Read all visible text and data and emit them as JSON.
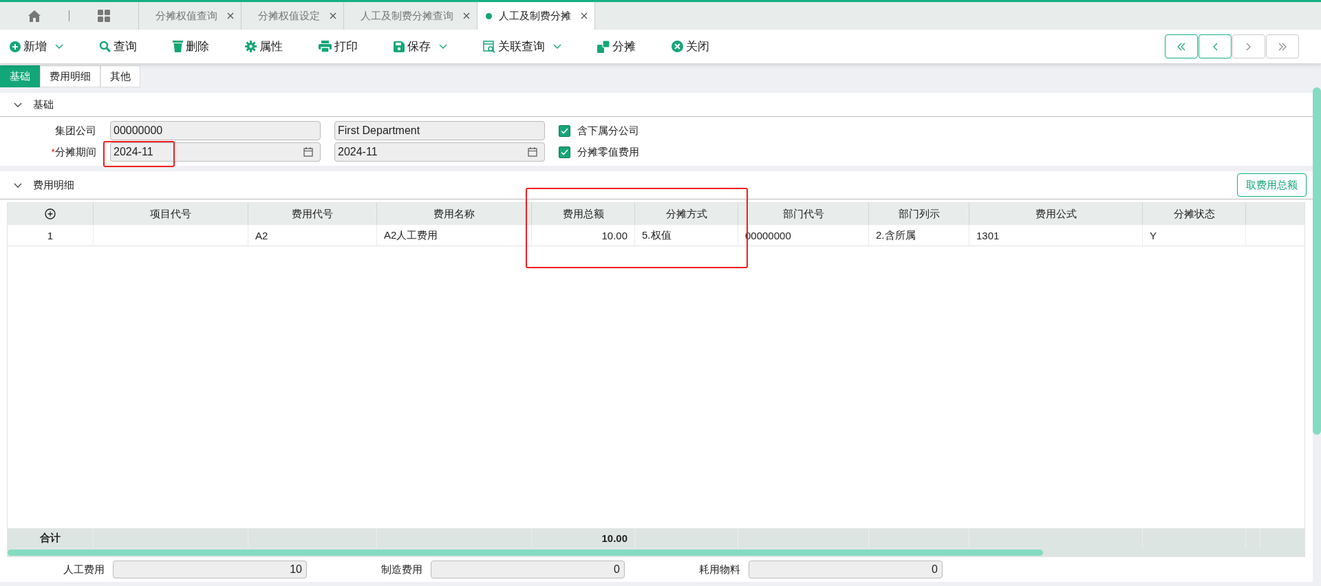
{
  "top_tabs": [
    {
      "label": "分摊权值查询",
      "selected": false
    },
    {
      "label": "分摊权值设定",
      "selected": false
    },
    {
      "label": "人工及制费分摊查询",
      "selected": false
    },
    {
      "label": "人工及制费分摊",
      "selected": true
    }
  ],
  "toolbar": [
    {
      "label": "新增",
      "dropdown": true
    },
    {
      "label": "查询",
      "dropdown": false
    },
    {
      "label": "删除",
      "dropdown": false
    },
    {
      "label": "属性",
      "dropdown": false
    },
    {
      "label": "打印",
      "dropdown": false
    },
    {
      "label": "保存",
      "dropdown": true
    },
    {
      "label": "关联查询",
      "dropdown": true
    },
    {
      "label": "分摊",
      "dropdown": false
    },
    {
      "label": "关闭",
      "dropdown": false
    }
  ],
  "pager": [
    {
      "disabled": false
    },
    {
      "disabled": false
    },
    {
      "disabled": true
    },
    {
      "disabled": true
    }
  ],
  "sub_tabs": [
    {
      "label": "基础",
      "selected": true
    },
    {
      "label": "费用明细",
      "selected": false
    },
    {
      "label": "其他",
      "selected": false
    }
  ],
  "basic_section": {
    "title": "基础",
    "expanded": true,
    "fields": [
      {
        "label": "集团公司",
        "code": "00000000",
        "name": "First Department",
        "calendar": false,
        "checkbox": {
          "label": "含下属分公司",
          "checked": true
        }
      },
      {
        "label": "分摊期间",
        "required_mark": "*",
        "code": "2024-11",
        "name": "2024-11",
        "calendar": true,
        "checkbox": {
          "label": "分摊零值费用",
          "checked": true
        }
      }
    ]
  },
  "detail_section": {
    "title": "费用明细",
    "expanded": true,
    "action": "取费用总额",
    "table": {
      "columns": [
        {
          "kind": "add"
        },
        {
          "kind": "text",
          "label": "项目代号"
        },
        {
          "kind": "text",
          "label": "费用代号"
        },
        {
          "kind": "text",
          "label": "费用名称"
        },
        {
          "kind": "number",
          "label": "费用总额"
        },
        {
          "kind": "text",
          "label": "分摊方式"
        },
        {
          "kind": "text",
          "label": "部门代号"
        },
        {
          "kind": "text",
          "label": "部门列示"
        },
        {
          "kind": "text",
          "label": "费用公式"
        },
        {
          "kind": "text",
          "label": "分摊状态"
        }
      ],
      "rows": [
        {
          "cells": [
            "1",
            null,
            "A2",
            "A2人工费用",
            "10.00",
            "5.权值",
            "00000000",
            "2.含所属",
            "1301",
            "Y"
          ]
        }
      ],
      "total": {
        "cells": [
          "合计",
          null,
          null,
          null,
          "10.00",
          null,
          null,
          null,
          null,
          null
        ]
      }
    }
  },
  "summary_fields": [
    {
      "label": "人工费用",
      "value": "10"
    },
    {
      "label": "制造费用",
      "value": "0"
    },
    {
      "label": "耗用物料",
      "value": "0"
    }
  ]
}
